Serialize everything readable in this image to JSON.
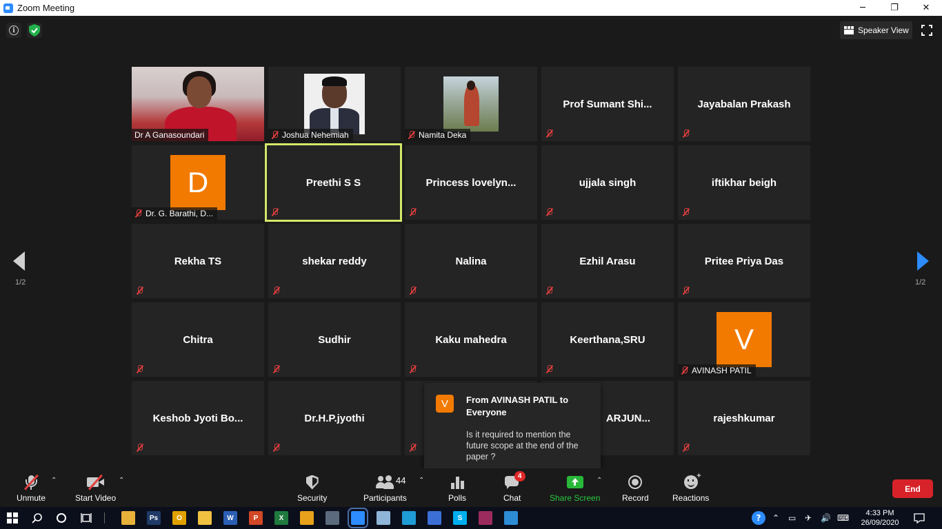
{
  "window": {
    "title": "Zoom Meeting",
    "controls": [
      "─",
      "❐",
      "✕"
    ]
  },
  "top": {
    "view_label": "Speaker View"
  },
  "pagination": {
    "left": "1/2",
    "right": "1/2"
  },
  "tiles": [
    {
      "label": "Dr A Ganasoundari",
      "kind": "video-ganas"
    },
    {
      "label": "Joshua Nehemiah",
      "kind": "photo-joshua",
      "muted": true
    },
    {
      "label": "Namita Deka",
      "kind": "photo-namita",
      "muted": true
    },
    {
      "name": "Prof  Sumant  Shi...",
      "muted": true
    },
    {
      "name": "Jayabalan Prakash",
      "muted": true
    },
    {
      "label": "Dr. G. Barathi, D...",
      "avatar": "D",
      "muted": true
    },
    {
      "name": "Preethi S S",
      "muted": true,
      "speaking": true
    },
    {
      "name": "Princess  lovelyn...",
      "muted": true
    },
    {
      "name": "ujjala singh",
      "muted": true
    },
    {
      "name": "iftikhar beigh",
      "muted": true
    },
    {
      "name": "Rekha TS",
      "muted": true
    },
    {
      "name": "shekar reddy",
      "muted": true
    },
    {
      "name": "Nalina",
      "muted": true
    },
    {
      "name": "Ezhil Arasu",
      "muted": true
    },
    {
      "name": "Pritee Priya Das",
      "muted": true
    },
    {
      "name": "Chitra",
      "muted": true
    },
    {
      "name": "Sudhir",
      "muted": true
    },
    {
      "name": "Kaku mahedra",
      "muted": true
    },
    {
      "name": "Keerthana,SRU",
      "muted": true
    },
    {
      "label": "AVINASH PATIL",
      "avatar": "V",
      "muted": true
    },
    {
      "name": "Keshob  Jyoti  Bo...",
      "muted": true
    },
    {
      "name": "Dr.H.P.jyothi",
      "muted": true
    },
    {
      "name": "",
      "muted": true
    },
    {
      "name": "ARJUN...",
      "muted": false
    },
    {
      "name": "rajeshkumar",
      "muted": true
    }
  ],
  "chat_popup": {
    "avatar": "V",
    "from": "From AVINASH PATIL to Everyone",
    "message": "Is it required to mention the future scope at the end of the paper ?"
  },
  "toolbar": {
    "unmute": "Unmute",
    "start_video": "Start Video",
    "security": "Security",
    "participants": "Participants",
    "participants_count": "44",
    "polls": "Polls",
    "chat": "Chat",
    "chat_badge": "4",
    "share_screen": "Share Screen",
    "record": "Record",
    "reactions": "Reactions",
    "end": "End"
  },
  "taskbar": {
    "apps": [
      {
        "name": "file-manager",
        "glyph": "",
        "color": "#e8b13a"
      },
      {
        "name": "photoshop",
        "glyph": "Ps",
        "color": "#1f3a66"
      },
      {
        "name": "outlook",
        "glyph": "O",
        "color": "#e0a100"
      },
      {
        "name": "folder",
        "glyph": "",
        "color": "#f0c040"
      },
      {
        "name": "word",
        "glyph": "W",
        "color": "#2b5fb4"
      },
      {
        "name": "powerpoint",
        "glyph": "P",
        "color": "#d24726"
      },
      {
        "name": "excel",
        "glyph": "X",
        "color": "#1f7a3d"
      },
      {
        "name": "chrome",
        "glyph": "",
        "color": "#e7a11b"
      },
      {
        "name": "calculator",
        "glyph": "",
        "color": "#5b6b7d"
      },
      {
        "name": "zoom",
        "glyph": "",
        "color": "#2d8cff"
      },
      {
        "name": "notepad",
        "glyph": "",
        "color": "#8fb6d8"
      },
      {
        "name": "edge",
        "glyph": "",
        "color": "#1f9bd6"
      },
      {
        "name": "store",
        "glyph": "",
        "color": "#3b6fd6"
      },
      {
        "name": "skype",
        "glyph": "S",
        "color": "#00aff0"
      },
      {
        "name": "winrar",
        "glyph": "",
        "color": "#9b2b5c"
      },
      {
        "name": "photos",
        "glyph": "",
        "color": "#2d8cd6"
      }
    ],
    "time": "4:33 PM",
    "date": "26/09/2020"
  }
}
